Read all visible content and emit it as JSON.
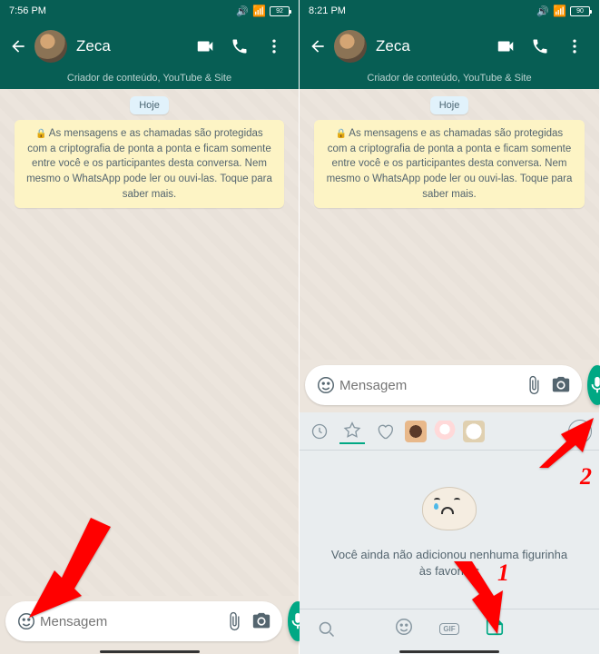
{
  "left": {
    "status_time": "7:56 PM",
    "battery": "92",
    "contact_name": "Zeca",
    "subtitle": "Criador de conteúdo, YouTube & Site",
    "date_label": "Hoje",
    "encryption_msg": "As mensagens e as chamadas são protegidas com a criptografia de ponta a ponta e ficam somente entre você e os participantes desta conversa. Nem mesmo o WhatsApp pode ler ou ouvi-las. Toque para saber mais.",
    "input_placeholder": "Mensagem"
  },
  "right": {
    "status_time": "8:21 PM",
    "battery": "90",
    "contact_name": "Zeca",
    "subtitle": "Criador de conteúdo, YouTube & Site",
    "date_label": "Hoje",
    "encryption_msg": "As mensagens e as chamadas são protegidas com a criptografia de ponta a ponta e ficam somente entre você e os participantes desta conversa. Nem mesmo o WhatsApp pode ler ou ouvi-las. Toque para saber mais.",
    "input_placeholder": "Mensagem",
    "favorites_empty": "Você ainda não adicionou nenhuma figurinha às favoritas",
    "gif_label": "GIF"
  },
  "annotations": {
    "one": "1",
    "two": "2"
  }
}
